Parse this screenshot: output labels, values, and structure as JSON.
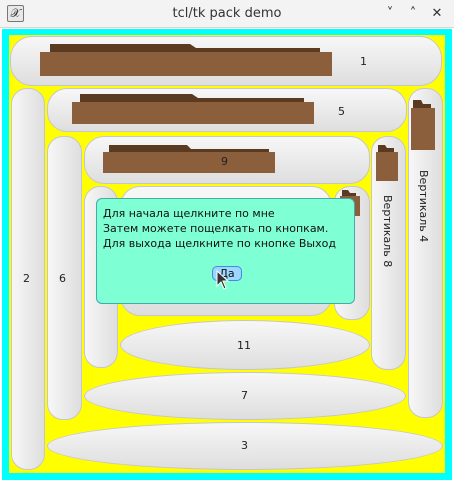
{
  "window": {
    "title": "tcl/tk pack demo",
    "app_icon": "x-app-icon",
    "controls": {
      "minimize": "˅",
      "maximize": "˄",
      "close": "✕"
    }
  },
  "colors": {
    "frame": "#00ffff",
    "canvas": "#ffff00",
    "dialog": "#7fffd4",
    "folder": "#8b5e3c"
  },
  "buttons": {
    "b1": "1",
    "b2": "2",
    "b3": "3",
    "b5": "5",
    "b6": "6",
    "b7": "7",
    "b9": "9",
    "b11": "11",
    "v4": "Вертикаль 4",
    "v8": "Вертикаль 8"
  },
  "dialog": {
    "lines": [
      "Для начала щелкните по мне",
      "Затем можете пощелкать по кнопкам.",
      "Для выхода щелкните по кнопке Выход"
    ],
    "ok_label": "Да"
  },
  "icons": {
    "cursor": "mouse-pointer-icon",
    "folder": "folder-icon"
  }
}
